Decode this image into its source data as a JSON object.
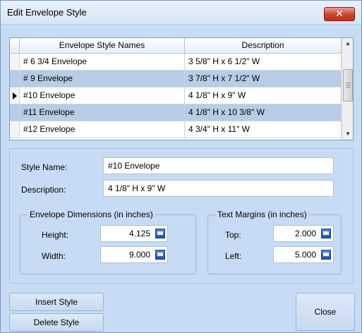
{
  "window": {
    "title": "Edit Envelope Style",
    "close_glyph": "✕"
  },
  "grid": {
    "columns": [
      "Envelope Style Names",
      "Description"
    ],
    "rows": [
      {
        "name": "# 6 3/4 Envelope",
        "description": "3 5/8\" H x 6 1/2\" W",
        "alt": false,
        "current": false
      },
      {
        "name": "# 9 Envelope",
        "description": "3 7/8\" H x 7 1/2\" W",
        "alt": true,
        "current": false
      },
      {
        "name": "#10 Envelope",
        "description": "4 1/8\" H x 9\" W",
        "alt": false,
        "current": true
      },
      {
        "name": "#11 Envelope",
        "description": "4 1/8\" H x 10 3/8\" W",
        "alt": true,
        "current": false
      },
      {
        "name": "#12 Envelope",
        "description": "4 3/4\" H x 11\" W",
        "alt": false,
        "current": false
      }
    ]
  },
  "form": {
    "style_name_label": "Style Name:",
    "style_name_value": "#10 Envelope",
    "description_label": "Description:",
    "description_value": "4 1/8\" H x 9\" W",
    "dimensions": {
      "title": "Envelope Dimensions (in inches)",
      "height_label": "Height:",
      "height_value": "4.125",
      "width_label": "Width:",
      "width_value": "9.000"
    },
    "margins": {
      "title": "Text Margins (in inches)",
      "top_label": "Top:",
      "top_value": "2.000",
      "left_label": "Left:",
      "left_value": "5.000"
    }
  },
  "buttons": {
    "insert": "Insert Style",
    "delete": "Delete Style",
    "close": "Close"
  },
  "icons": {
    "current_row": "row-pointer-icon",
    "calculator": "calculator-icon",
    "scroll_up": "▲",
    "scroll_down": "▼"
  },
  "colors": {
    "background": "#c7dcf4",
    "alt_row": "#b7cde6",
    "close_button": "#c8412d"
  }
}
